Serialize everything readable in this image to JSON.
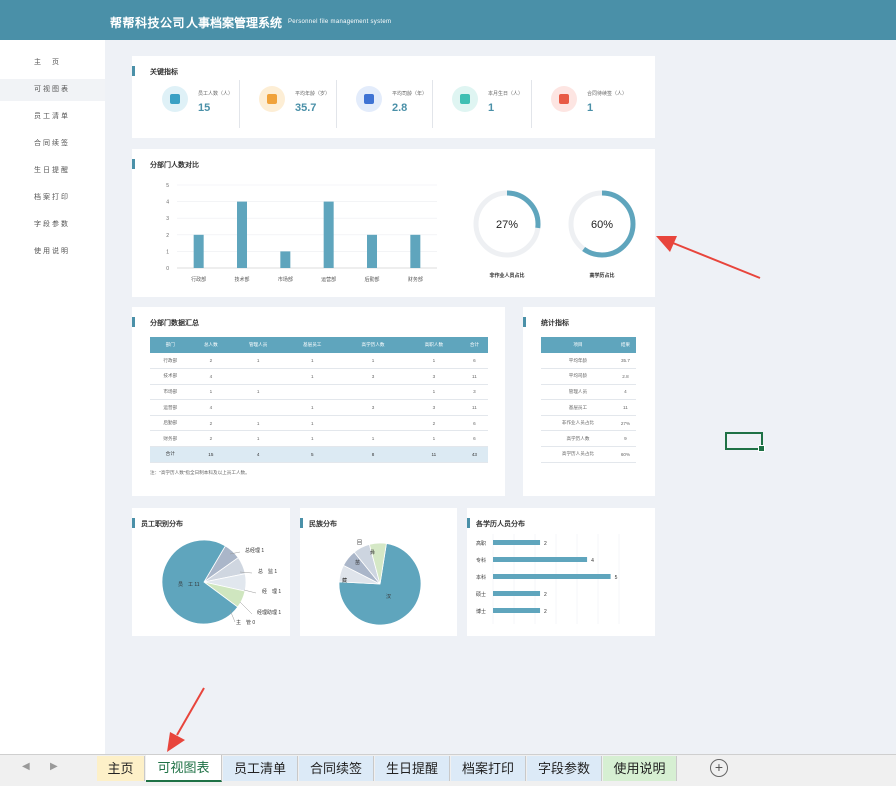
{
  "header": {
    "company": "帮帮科技公司",
    "system": "人事档案管理系统",
    "subtitle": "Personnel file management system"
  },
  "sidebar": {
    "items": [
      {
        "label": "主　页"
      },
      {
        "label": "可视图表"
      },
      {
        "label": "员工清单"
      },
      {
        "label": "合同续签"
      },
      {
        "label": "生日提醒"
      },
      {
        "label": "档案打印"
      },
      {
        "label": "字段参数"
      },
      {
        "label": "使用说明"
      }
    ]
  },
  "kpi": {
    "title": "关键指标",
    "items": [
      {
        "label": "员工人数（人）",
        "value": "15",
        "color": "#dff1f7",
        "icon": "clipboard-icon"
      },
      {
        "label": "平均年龄（岁）",
        "value": "35.7",
        "color": "#fdeed5",
        "icon": "camera-icon"
      },
      {
        "label": "平均司龄（年）",
        "value": "2.8",
        "color": "#e3ecfb",
        "icon": "house-icon"
      },
      {
        "label": "本月生日（人）",
        "value": "1",
        "color": "#dff5f2",
        "icon": "person-icon"
      },
      {
        "label": "合同待续签（人）",
        "value": "1",
        "color": "#fde5e2",
        "icon": "alarm-icon"
      }
    ]
  },
  "dept_chart": {
    "title": "分部门人数对比"
  },
  "gauges": [
    {
      "value": "27%",
      "label": "非作业人员占比"
    },
    {
      "value": "60%",
      "label": "高学历占比"
    }
  ],
  "chart_data": [
    {
      "type": "bar",
      "title": "分部门人数对比",
      "categories": [
        "行政部",
        "技术部",
        "市场部",
        "运营部",
        "后勤部",
        "财务部"
      ],
      "values": [
        2,
        4,
        1,
        4,
        2,
        2
      ],
      "ylim": [
        0,
        5
      ],
      "yticks": [
        "0",
        "1",
        "2",
        "3",
        "4",
        "5"
      ]
    },
    {
      "type": "pie",
      "title": "员工职别分布",
      "slices": [
        {
          "label": "员　工",
          "value": 11
        },
        {
          "label": "总经理",
          "value": 1
        },
        {
          "label": "总　监",
          "value": 1
        },
        {
          "label": "经　理",
          "value": 1
        },
        {
          "label": "经理助理",
          "value": 1
        },
        {
          "label": "主　管",
          "value": 0
        }
      ]
    },
    {
      "type": "pie",
      "title": "民族分布",
      "slices": [
        {
          "label": "汉",
          "value": 11
        },
        {
          "label": "藏",
          "value": 1
        },
        {
          "label": "苗",
          "value": 1
        },
        {
          "label": "回",
          "value": 1
        },
        {
          "label": "彝",
          "value": 1
        }
      ]
    },
    {
      "type": "bar",
      "orientation": "horizontal",
      "title": "各学历人员分布",
      "categories": [
        "高职",
        "专科",
        "本科",
        "硕士",
        "博士"
      ],
      "values": [
        2,
        4,
        5,
        2,
        2
      ]
    }
  ],
  "dept_table": {
    "title": "分部门数据汇总",
    "headers": [
      "部门",
      "总人数",
      "管理人员",
      "基层员工",
      "高学历人数",
      "高职人数",
      "合计"
    ],
    "rows": [
      [
        "行政部",
        "2",
        "1",
        "1",
        "1",
        "1",
        "6"
      ],
      [
        "技术部",
        "4",
        "",
        "1",
        "3",
        "3",
        "11"
      ],
      [
        "市场部",
        "1",
        "1",
        "",
        "",
        "1",
        "3"
      ],
      [
        "运营部",
        "4",
        "",
        "1",
        "3",
        "3",
        "11"
      ],
      [
        "后勤部",
        "2",
        "1",
        "1",
        "",
        "2",
        "6"
      ],
      [
        "财务部",
        "2",
        "1",
        "1",
        "1",
        "1",
        "6"
      ]
    ],
    "sum": [
      "合计",
      "15",
      "4",
      "5",
      "8",
      "11",
      "43"
    ],
    "note": "注：\"高学历人数\"指全日制本科及以上员工人数。"
  },
  "stats_table": {
    "title": "统计指标",
    "headers": [
      "项目",
      "结果"
    ],
    "rows": [
      [
        "平均年龄",
        "35.7"
      ],
      [
        "平均司龄",
        "2.8"
      ],
      [
        "管理人员",
        "4"
      ],
      [
        "基层员工",
        "11"
      ],
      [
        "非作业人员占比",
        "27%"
      ],
      [
        "高学历人数",
        "9"
      ],
      [
        "高学历人员占比",
        "60%"
      ]
    ]
  },
  "sheet_tabs": [
    {
      "label": "主页",
      "bg": "#fdf0c8"
    },
    {
      "label": "可视图表",
      "bg": "#ffffff",
      "active": true
    },
    {
      "label": "员工清单",
      "bg": "#dceaf7"
    },
    {
      "label": "合同续签",
      "bg": "#dceaf7"
    },
    {
      "label": "生日提醒",
      "bg": "#dceaf7"
    },
    {
      "label": "档案打印",
      "bg": "#dceaf7"
    },
    {
      "label": "字段参数",
      "bg": "#dceaf7"
    },
    {
      "label": "使用说明",
      "bg": "#d6efd2"
    }
  ],
  "colors": {
    "accent": "#4a90a8",
    "bar": "#5fa5bd",
    "arrow": "#e8453c"
  }
}
